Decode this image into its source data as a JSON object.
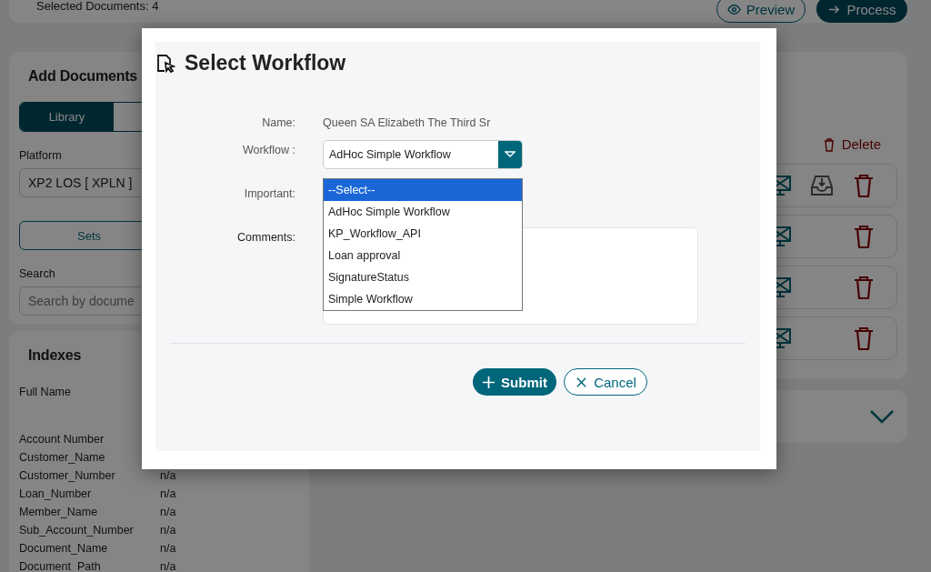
{
  "top_bar": {
    "selected_count": "Selected Documents: 4",
    "buttons": [
      {
        "label": "Preview",
        "kind": "outline"
      },
      {
        "label": "Process",
        "kind": "filled"
      }
    ]
  },
  "add_documents": {
    "title": "Add Documents",
    "tabs": [
      {
        "label": "Library",
        "selected": true
      },
      {
        "selected": false
      }
    ],
    "platform_label": "Platform",
    "platform_value": "XP2 LOS [ XPLN ]",
    "sets_button": "Sets",
    "search_label": "Search",
    "search_placeholder": "Search by docume"
  },
  "indexes": {
    "title": "Indexes",
    "full_name_label": "Full Name",
    "rows": [
      {
        "label": "Account Number"
      },
      {
        "label": "Customer_Name"
      },
      {
        "label": "Customer_Number",
        "value": "n/a"
      },
      {
        "label": "Loan_Number",
        "value": "n/a"
      },
      {
        "label": "Member_Name",
        "value": "n/a"
      },
      {
        "label": "Sub_Account_Number",
        "value": "n/a"
      },
      {
        "label": "Document_Name",
        "value": "n/a"
      },
      {
        "label": "Document_Path",
        "value": "n/a"
      }
    ]
  },
  "documents": {
    "delete_button": "Delete",
    "rows": [
      {
        "downloadable": true
      },
      {
        "downloadable": false
      },
      {
        "downloadable": false
      },
      {
        "downloadable": false
      }
    ]
  },
  "dialog": {
    "title": "Select Workflow",
    "name_label": "Name:",
    "name_value": "Queen SA Elizabeth The Third Sr",
    "workflow_label": "Workflow :",
    "workflow_value": "AdHoc Simple Workflow",
    "important_label": "Important:",
    "comments_label": "Comments:",
    "workflow_options": [
      {
        "label": "--Select--",
        "selected": true
      },
      {
        "label": "AdHoc Simple Workflow",
        "selected": false
      },
      {
        "label": "KP_Workflow_API",
        "selected": false
      },
      {
        "label": "Loan approval",
        "selected": false
      },
      {
        "label": "SignatureStatus",
        "selected": false
      },
      {
        "label": "Simple Workflow",
        "selected": false
      }
    ],
    "submit_button": "Submit",
    "cancel_button": "Cancel"
  }
}
